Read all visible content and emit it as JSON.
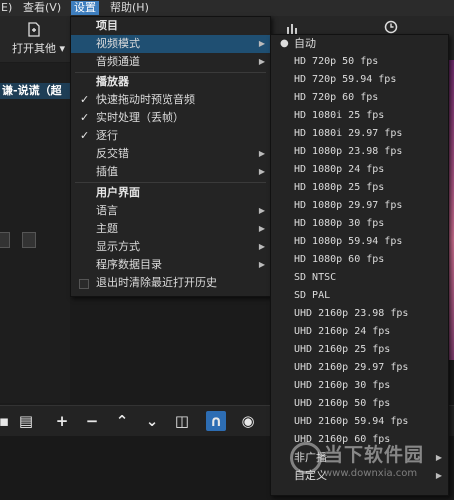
{
  "menubar": {
    "items": [
      {
        "label": "E)",
        "active": false
      },
      {
        "label": "查看(V)",
        "active": false
      },
      {
        "label": "设置",
        "active": true
      },
      {
        "label": "帮助(H)",
        "active": false
      }
    ]
  },
  "toolbar": {
    "open_other_label": "打开其他"
  },
  "left_panel": {
    "playlist_header": "谦-说谎（超"
  },
  "settings_menu": {
    "items": [
      {
        "type": "section",
        "label": "项目"
      },
      {
        "type": "submenu",
        "label": "视频模式",
        "highlighted": true
      },
      {
        "type": "submenu",
        "label": "音频通道"
      },
      {
        "type": "section",
        "label": "播放器"
      },
      {
        "type": "check",
        "label": "快速拖动时预览音频",
        "checked": true
      },
      {
        "type": "check",
        "label": "实时处理（丢帧）",
        "checked": true
      },
      {
        "type": "check",
        "label": "逐行",
        "checked": true
      },
      {
        "type": "submenu",
        "label": "反交错"
      },
      {
        "type": "submenu",
        "label": "插值"
      },
      {
        "type": "section",
        "label": "用户界面"
      },
      {
        "type": "submenu",
        "label": "语言"
      },
      {
        "type": "submenu",
        "label": "主题"
      },
      {
        "type": "submenu",
        "label": "显示方式"
      },
      {
        "type": "submenu",
        "label": "程序数据目录"
      },
      {
        "type": "checkbox",
        "label": "退出时清除最近打开历史",
        "checked": false
      }
    ]
  },
  "video_mode_menu": {
    "items": [
      {
        "label": "自动",
        "selected": true
      },
      {
        "label": "HD 720p 50 fps"
      },
      {
        "label": "HD 720p 59.94 fps"
      },
      {
        "label": "HD 720p 60 fps"
      },
      {
        "label": "HD 1080i 25 fps"
      },
      {
        "label": "HD 1080i 29.97 fps"
      },
      {
        "label": "HD 1080p 23.98 fps"
      },
      {
        "label": "HD 1080p 24 fps"
      },
      {
        "label": "HD 1080p 25 fps"
      },
      {
        "label": "HD 1080p 29.97 fps"
      },
      {
        "label": "HD 1080p 30 fps"
      },
      {
        "label": "HD 1080p 59.94 fps"
      },
      {
        "label": "HD 1080p 60 fps"
      },
      {
        "label": "SD NTSC"
      },
      {
        "label": "SD PAL"
      },
      {
        "label": "UHD 2160p 23.98 fps"
      },
      {
        "label": "UHD 2160p 24 fps"
      },
      {
        "label": "UHD 2160p 25 fps"
      },
      {
        "label": "UHD 2160p 29.97 fps"
      },
      {
        "label": "UHD 2160p 30 fps"
      },
      {
        "label": "UHD 2160p 50 fps"
      },
      {
        "label": "UHD 2160p 59.94 fps"
      },
      {
        "label": "UHD 2160p 60 fps"
      },
      {
        "label": "非广播",
        "submenu": true
      },
      {
        "label": "自定义",
        "submenu": true
      }
    ]
  },
  "watermark": {
    "text": "当下软件园",
    "url": "www.downxia.com"
  },
  "colors": {
    "menu_bg": "#242424",
    "highlight": "#1f4f72",
    "active_menubar": "#3f7fbf"
  }
}
